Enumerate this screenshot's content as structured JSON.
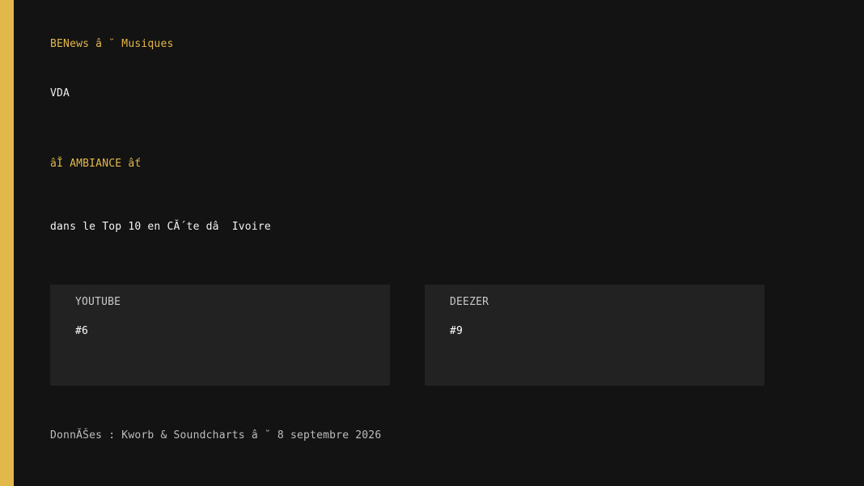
{
  "colors": {
    "accent": "#e3b84a",
    "background": "#131313",
    "card": "#222222"
  },
  "brand": "BENews â ˘ Musiques",
  "artist": "VDA",
  "song": "âĬ AMBIANCE âť",
  "headline": "dans le Top 10 en CĂ´te dâ  Ivoire",
  "cards": [
    {
      "platform": "YOUTUBE",
      "rank": "#6"
    },
    {
      "platform": "DEEZER",
      "rank": "#9"
    }
  ],
  "footer": "DonnĂŠes : Kworb & Soundcharts â ˘ 8 septembre 2026"
}
